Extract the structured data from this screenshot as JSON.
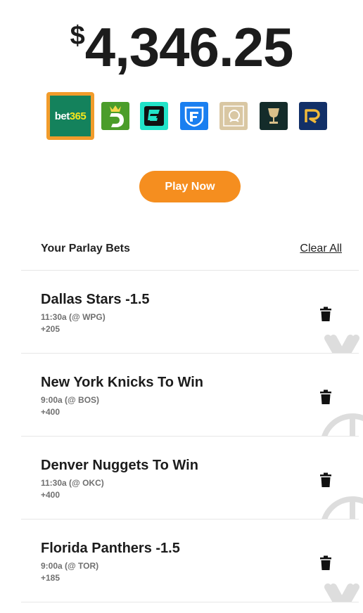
{
  "payout": {
    "currency": "$",
    "amount": "4,346.25"
  },
  "sportsbooks": [
    {
      "name": "bet365",
      "icon": "bet365-logo-icon",
      "bg": "#14825c",
      "selected": true
    },
    {
      "name": "DraftKings",
      "icon": "draftkings-logo-icon",
      "bg": "#4b9d2a"
    },
    {
      "name": "ESPN BET",
      "icon": "espnbet-logo-icon",
      "bg": "#22e3c8"
    },
    {
      "name": "FanDuel",
      "icon": "fanduel-logo-icon",
      "bg": "#1a7ff0"
    },
    {
      "name": "Caesars",
      "icon": "caesars-logo-icon",
      "bg": "#d9c7a3"
    },
    {
      "name": "BetRivers",
      "icon": "chalice-logo-icon",
      "bg": "#142c2a"
    },
    {
      "name": "Rivers",
      "icon": "rivers-logo-icon",
      "bg": "#123068"
    }
  ],
  "play_now_label": "Play Now",
  "parlay": {
    "title": "Your Parlay Bets",
    "clear_label": "Clear All",
    "bets": [
      {
        "title": "Dallas Stars -1.5",
        "time": "11:30a (@ WPG)",
        "odds": "+205",
        "sport": "hockey"
      },
      {
        "title": "New York Knicks To Win",
        "time": "9:00a (@ BOS)",
        "odds": "+400",
        "sport": "basketball"
      },
      {
        "title": "Denver Nuggets To Win",
        "time": "11:30a (@ OKC)",
        "odds": "+400",
        "sport": "basketball"
      },
      {
        "title": "Florida Panthers -1.5",
        "time": "9:00a (@ TOR)",
        "odds": "+185",
        "sport": "hockey"
      }
    ]
  },
  "colors": {
    "accent": "#f58e1f",
    "selected_border": "#f29c2b"
  }
}
